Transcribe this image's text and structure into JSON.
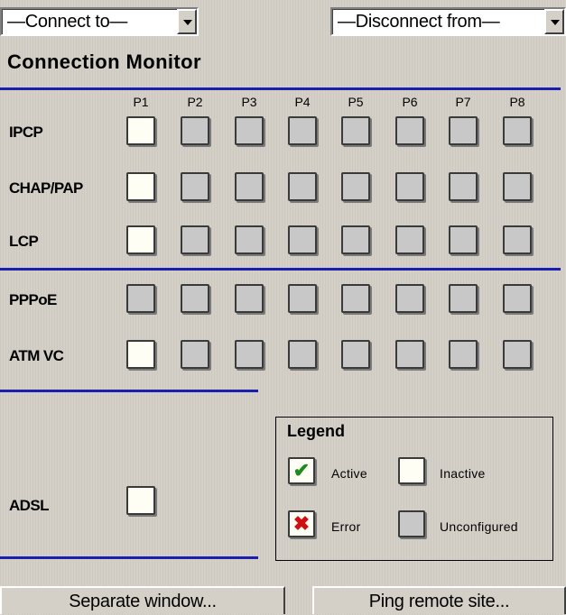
{
  "connect_select": {
    "value": "—Connect to—"
  },
  "disconnect_select": {
    "value": "—Disconnect from—"
  },
  "title": "Connection Monitor",
  "ports": [
    "P1",
    "P2",
    "P3",
    "P4",
    "P5",
    "P6",
    "P7",
    "P8"
  ],
  "rows": [
    {
      "label": "IPCP",
      "states": [
        "inactive",
        "unconfigured",
        "unconfigured",
        "unconfigured",
        "unconfigured",
        "unconfigured",
        "unconfigured",
        "unconfigured"
      ]
    },
    {
      "label": "CHAP/PAP",
      "states": [
        "inactive",
        "unconfigured",
        "unconfigured",
        "unconfigured",
        "unconfigured",
        "unconfigured",
        "unconfigured",
        "unconfigured"
      ]
    },
    {
      "label": "LCP",
      "states": [
        "inactive",
        "unconfigured",
        "unconfigured",
        "unconfigured",
        "unconfigured",
        "unconfigured",
        "unconfigured",
        "unconfigured"
      ]
    },
    {
      "label": "PPPoE",
      "states": [
        "unconfigured",
        "unconfigured",
        "unconfigured",
        "unconfigured",
        "unconfigured",
        "unconfigured",
        "unconfigured",
        "unconfigured"
      ]
    },
    {
      "label": "ATM VC",
      "states": [
        "inactive",
        "unconfigured",
        "unconfigured",
        "unconfigured",
        "unconfigured",
        "unconfigured",
        "unconfigured",
        "unconfigured"
      ]
    }
  ],
  "adsl": {
    "label": "ADSL",
    "state": "inactive"
  },
  "legend": {
    "title": "Legend",
    "active": {
      "label": "Active",
      "symbol": "✔"
    },
    "inactive": {
      "label": "Inactive"
    },
    "error": {
      "label": "Error",
      "symbol": "✖"
    },
    "unconfigured": {
      "label": "Unconfigured"
    }
  },
  "colors": {
    "rule": "#1a1fb0",
    "inactive_fill": "#fefef4",
    "unconfigured_fill": "#c8c8c8",
    "active_check": "#1e8a1e",
    "error_x": "#d01010"
  },
  "buttons": {
    "separate_window": "Separate window...",
    "ping_remote": "Ping remote site..."
  }
}
